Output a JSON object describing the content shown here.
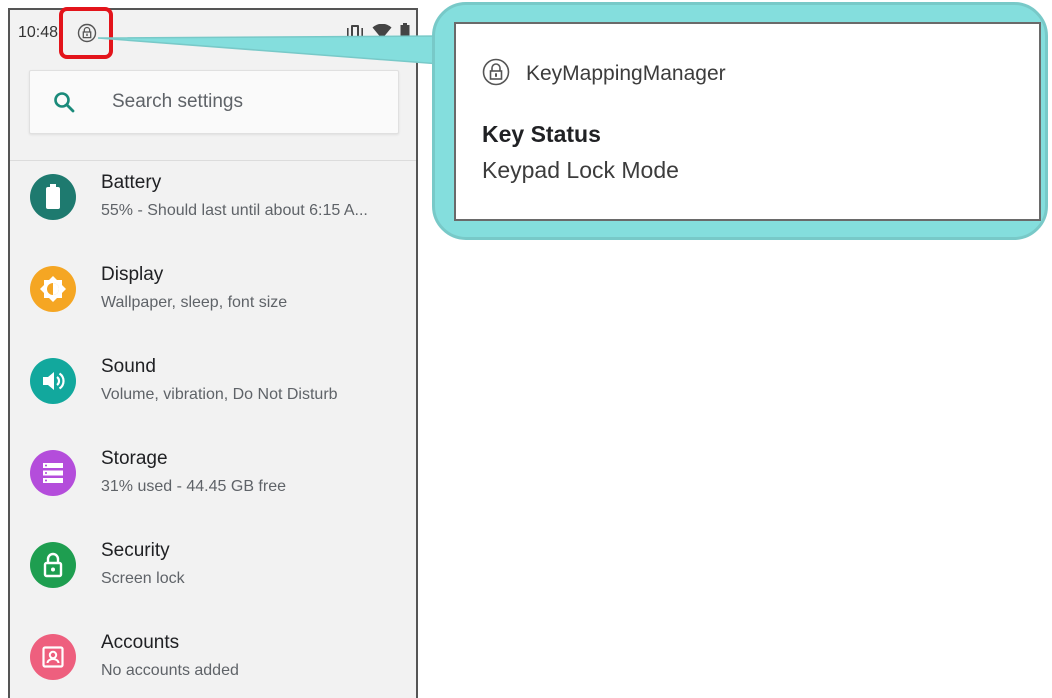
{
  "status_bar": {
    "time": "10:48",
    "notification_icon": "lock-icon",
    "right_icons": [
      "vibrate-icon",
      "wifi-icon",
      "battery-icon"
    ]
  },
  "search": {
    "placeholder": "Search settings"
  },
  "settings_items": [
    {
      "title": "Battery",
      "subtitle": "55% - Should last until about 6:15 A...",
      "icon": "battery-icon",
      "color": "#1e7a6f"
    },
    {
      "title": "Display",
      "subtitle": "Wallpaper, sleep, font size",
      "icon": "brightness-icon",
      "color": "#f5a623"
    },
    {
      "title": "Sound",
      "subtitle": "Volume, vibration, Do Not Disturb",
      "icon": "speaker-icon",
      "color": "#12a89d"
    },
    {
      "title": "Storage",
      "subtitle": "31% used - 44.45 GB free",
      "icon": "storage-icon",
      "color": "#b44ddb"
    },
    {
      "title": "Security",
      "subtitle": "Screen lock",
      "icon": "lock-icon",
      "color": "#1e9e50"
    },
    {
      "title": "Accounts",
      "subtitle": "No accounts added",
      "icon": "account-icon",
      "color": "#ee5f7e"
    }
  ],
  "notification": {
    "app_name": "KeyMappingManager",
    "title": "Key Status",
    "text": "Keypad Lock Mode"
  },
  "colors": {
    "highlight": "#e3141b",
    "callout": "#84dedd",
    "search_icon": "#1a8a7a"
  }
}
